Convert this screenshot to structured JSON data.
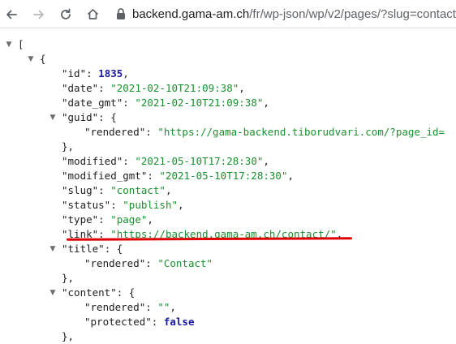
{
  "browser": {
    "url_host": "backend.gama-am.ch",
    "url_path": "/fr/wp-json/wp/v2/pages/?slug=contact",
    "back_icon": "arrow-left-icon",
    "forward_icon": "arrow-right-icon",
    "reload_icon": "reload-icon",
    "home_icon": "home-icon",
    "lock_icon": "lock-icon"
  },
  "json": {
    "open_array": "[",
    "open_obj": "{",
    "id_key": "\"id\"",
    "id_val": "1835",
    "date_key": "\"date\"",
    "date_val": "\"2021-02-10T21:09:38\"",
    "date_gmt_key": "\"date_gmt\"",
    "date_gmt_val": "\"2021-02-10T21:09:38\"",
    "guid_key": "\"guid\"",
    "guid_rendered_key": "\"rendered\"",
    "guid_rendered_val": "\"https://gama-backend.tiborudvari.com/?page_id=",
    "close_obj_comma": "},",
    "modified_key": "\"modified\"",
    "modified_val": "\"2021-05-10T17:28:30\"",
    "modified_gmt_key": "\"modified_gmt\"",
    "modified_gmt_val": "\"2021-05-10T17:28:30\"",
    "slug_key": "\"slug\"",
    "slug_val": "\"contact\"",
    "status_key": "\"status\"",
    "status_val": "\"publish\"",
    "type_key": "\"type\"",
    "type_val": "\"page\"",
    "link_key": "\"link\"",
    "link_val": "\"https://backend.gama-am.ch/contact/\"",
    "title_key": "\"title\"",
    "title_rendered_key": "\"rendered\"",
    "title_rendered_val": "\"Contact\"",
    "content_key": "\"content\"",
    "content_rendered_key": "\"rendered\"",
    "content_rendered_val": "\"\"",
    "content_protected_key": "\"protected\"",
    "content_protected_val": "false",
    "colon": ": ",
    "comma": ",",
    "brace_open": "{"
  },
  "colors": {
    "annotation": "#e00000",
    "string": "#1a8f2e",
    "number": "#1a1aa6"
  }
}
